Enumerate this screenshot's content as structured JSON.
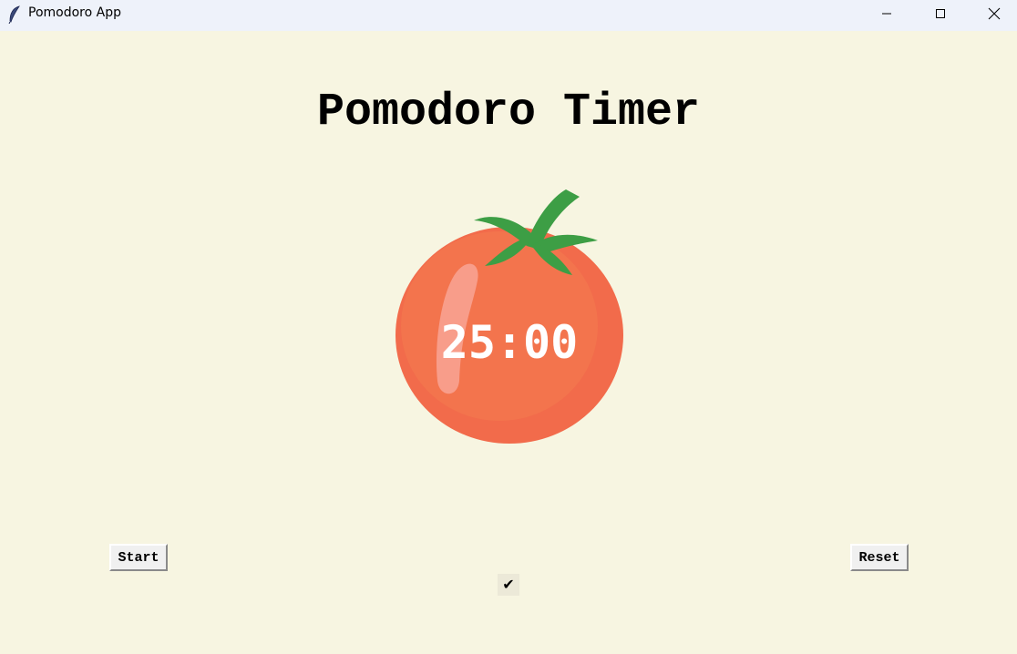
{
  "window": {
    "title": "Pomodoro App",
    "icon": "feather-icon"
  },
  "controls": {
    "minimize_icon": "minimize-icon",
    "maximize_icon": "maximize-icon",
    "close_icon": "close-icon"
  },
  "main": {
    "heading": "Pomodoro Timer",
    "timer": "25:00",
    "start_label": "Start",
    "reset_label": "Reset",
    "checkmarks": "✔"
  },
  "colors": {
    "background": "#f7f5e1",
    "tomato": "#f26b4b",
    "leaf": "#3d9e45",
    "timer_text": "#ffffff"
  }
}
